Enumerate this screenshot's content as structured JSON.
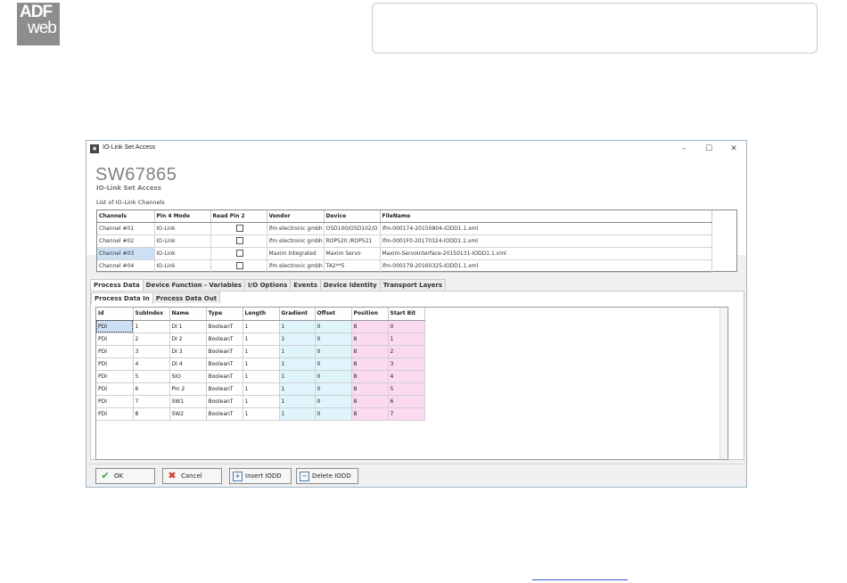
{
  "logo": {
    "line1": "ADF",
    "line2": "web"
  },
  "window": {
    "title": "IO-Link Set Access",
    "product": "SW67865",
    "subtitle": "IO-Link Set Access",
    "list_label": "List of IO-Link Channels",
    "controls": {
      "minimize": "–",
      "maximize": "☐",
      "close": "✕"
    }
  },
  "channels": {
    "headers": [
      "Channels",
      "Pin 4 Mode",
      "Read Pin 2",
      "Vendor",
      "Device",
      "FileName"
    ],
    "rows": [
      [
        "Channel #01",
        "IO-Link",
        "",
        "ifm electronic gmbh",
        "O5D100/O5D102/O",
        "ifm-000174-20150804-IODD1.1.xml"
      ],
      [
        "Channel #02",
        "IO-Link",
        "",
        "ifm electronic gmbh",
        "ROP520 /ROP521",
        "ifm-0001F0-20170324-IODD1.1.xml"
      ],
      [
        "Channel #03",
        "IO-Link",
        "",
        "Maxim Integrated",
        "Maxim Servo",
        "Maxim-ServoInterface-20150131-IODD1.1.xml"
      ],
      [
        "Channel #04",
        "IO-Link",
        "",
        "ifm electronic gmbh",
        "TA2**5",
        "ifm-000179-20160325-IODD1.1.xml"
      ]
    ]
  },
  "tabs": [
    "Process Data",
    "Device Function - Variables",
    "I/O Options",
    "Events",
    "Device Identity",
    "Transport Layers"
  ],
  "subtabs": [
    "Process Data In",
    "Process Data Out"
  ],
  "process_data": {
    "headers": [
      "Id",
      "SubIndex",
      "Name",
      "Type",
      "Length",
      "Gradient",
      "Offset",
      "Position",
      "Start Bit"
    ],
    "rows": [
      [
        "PDI",
        "1",
        "DI 1",
        "BooleanT",
        "1",
        "1",
        "0",
        "8",
        "0"
      ],
      [
        "PDI",
        "2",
        "DI 2",
        "BooleanT",
        "1",
        "1",
        "0",
        "8",
        "1"
      ],
      [
        "PDI",
        "3",
        "DI 3",
        "BooleanT",
        "1",
        "1",
        "0",
        "8",
        "2"
      ],
      [
        "PDI",
        "4",
        "DI 4",
        "BooleanT",
        "1",
        "1",
        "0",
        "8",
        "3"
      ],
      [
        "PDI",
        "5",
        "SIO",
        "BooleanT",
        "1",
        "1",
        "0",
        "8",
        "4"
      ],
      [
        "PDI",
        "6",
        "Pin 2",
        "BooleanT",
        "1",
        "1",
        "0",
        "8",
        "5"
      ],
      [
        "PDI",
        "7",
        "SW1",
        "BooleanT",
        "1",
        "1",
        "0",
        "8",
        "6"
      ],
      [
        "PDI",
        "8",
        "SW2",
        "BooleanT",
        "1",
        "1",
        "0",
        "8",
        "7"
      ]
    ]
  },
  "buttons": {
    "ok": "OK",
    "cancel": "Cancel",
    "insert": "Insert IODD",
    "delete": "Delete IODD"
  },
  "colors": {
    "cyan_col": "#dff5fb",
    "pink_col": "#fbd9f0",
    "selection": "#cce0f5"
  }
}
